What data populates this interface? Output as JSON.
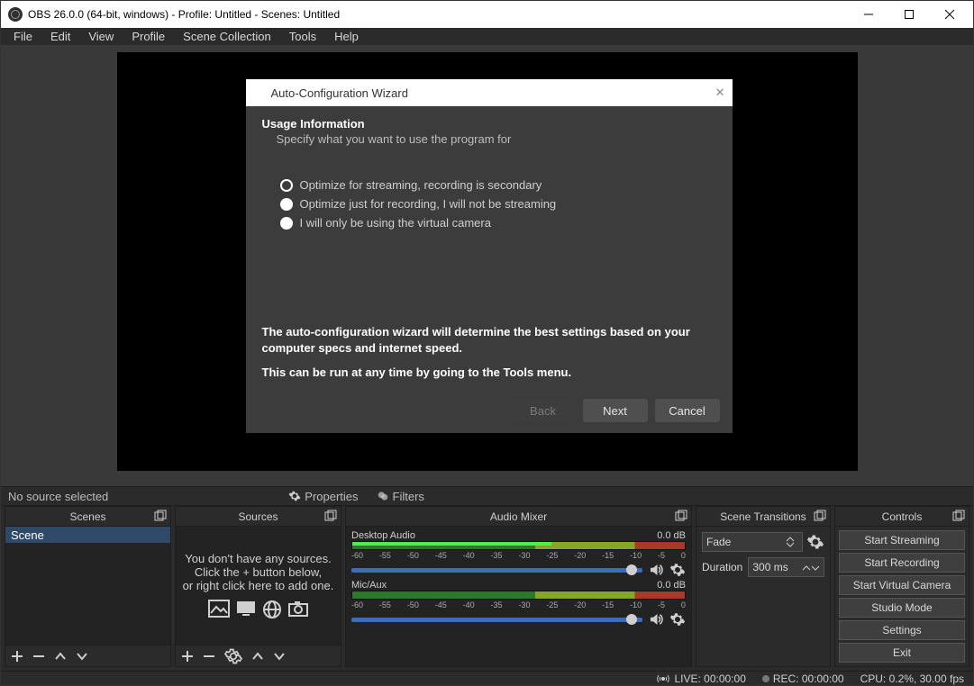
{
  "titlebar": {
    "text": "OBS 26.0.0 (64-bit, windows) - Profile: Untitled - Scenes: Untitled"
  },
  "menu": {
    "items": [
      "File",
      "Edit",
      "View",
      "Profile",
      "Scene Collection",
      "Tools",
      "Help"
    ]
  },
  "wizard": {
    "title": "Auto-Configuration Wizard",
    "heading": "Usage Information",
    "subheading": "Specify what you want to use the program for",
    "options": [
      "Optimize for streaming, recording is secondary",
      "Optimize just for recording, I will not be streaming",
      "I will only be using the virtual camera"
    ],
    "selected_index": 0,
    "desc1": "The auto-configuration wizard will determine the best settings based on your computer specs and internet speed.",
    "desc2": "This can be run at any time by going to the Tools menu.",
    "back": "Back",
    "next": "Next",
    "cancel": "Cancel"
  },
  "srcbar": {
    "no_source": "No source selected",
    "properties": "Properties",
    "filters": "Filters"
  },
  "panels": {
    "scenes": "Scenes",
    "sources": "Sources",
    "mixer": "Audio Mixer",
    "transitions": "Scene Transitions",
    "controls": "Controls"
  },
  "scenes": {
    "items": [
      "Scene"
    ]
  },
  "sources_empty": {
    "l1": "You don't have any sources.",
    "l2": "Click the + button below,",
    "l3": "or right click here to add one."
  },
  "mixer": {
    "channels": [
      {
        "name": "Desktop Audio",
        "level": "0.0 dB"
      },
      {
        "name": "Mic/Aux",
        "level": "0.0 dB"
      }
    ],
    "ticks": [
      "-60",
      "-55",
      "-50",
      "-45",
      "-40",
      "-35",
      "-30",
      "-25",
      "-20",
      "-15",
      "-10",
      "-5",
      "0"
    ]
  },
  "transitions": {
    "current": "Fade",
    "duration_label": "Duration",
    "duration_value": "300 ms"
  },
  "controls": {
    "buttons": [
      "Start Streaming",
      "Start Recording",
      "Start Virtual Camera",
      "Studio Mode",
      "Settings",
      "Exit"
    ]
  },
  "status": {
    "live": "LIVE: 00:00:00",
    "rec": "REC: 00:00:00",
    "cpu": "CPU: 0.2%, 30.00 fps"
  }
}
